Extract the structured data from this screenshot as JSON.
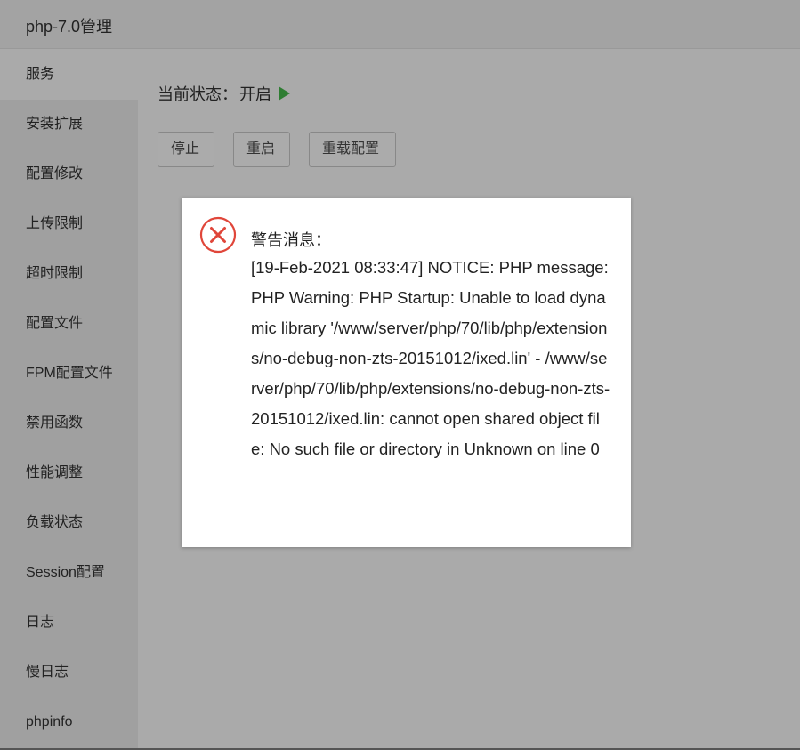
{
  "window": {
    "title": "php-7.0管理"
  },
  "sidebar": {
    "items": [
      {
        "label": "服务"
      },
      {
        "label": "安装扩展"
      },
      {
        "label": "配置修改"
      },
      {
        "label": "上传限制"
      },
      {
        "label": "超时限制"
      },
      {
        "label": "配置文件"
      },
      {
        "label": "FPM配置文件"
      },
      {
        "label": "禁用函数"
      },
      {
        "label": "性能调整"
      },
      {
        "label": "负载状态"
      },
      {
        "label": "Session配置"
      },
      {
        "label": "日志"
      },
      {
        "label": "慢日志"
      },
      {
        "label": "phpinfo"
      }
    ],
    "active_index": 0
  },
  "service": {
    "status_label": "当前状态：",
    "status_value": "开启",
    "status_icon": "play-icon",
    "buttons": {
      "stop": "停止",
      "restart": "重启",
      "reload": "重载配置"
    }
  },
  "dialog": {
    "icon": "error-icon",
    "title": "警告消息：",
    "message": "[19-Feb-2021 08:33:47] NOTICE: PHP message: PHP Warning: PHP Startup: Unable to load dynamic library '/www/server/php/70/lib/php/extensions/no-debug-non-zts-20151012/ixed.lin' - /www/server/php/70/lib/php/extensions/no-debug-non-zts-20151012/ixed.lin: cannot open shared object file: No such file or directory in Unknown on line 0"
  },
  "colors": {
    "overlay_gray": "#aaaaaa",
    "status_green": "#2e7d32",
    "error_red": "#e0463a"
  }
}
